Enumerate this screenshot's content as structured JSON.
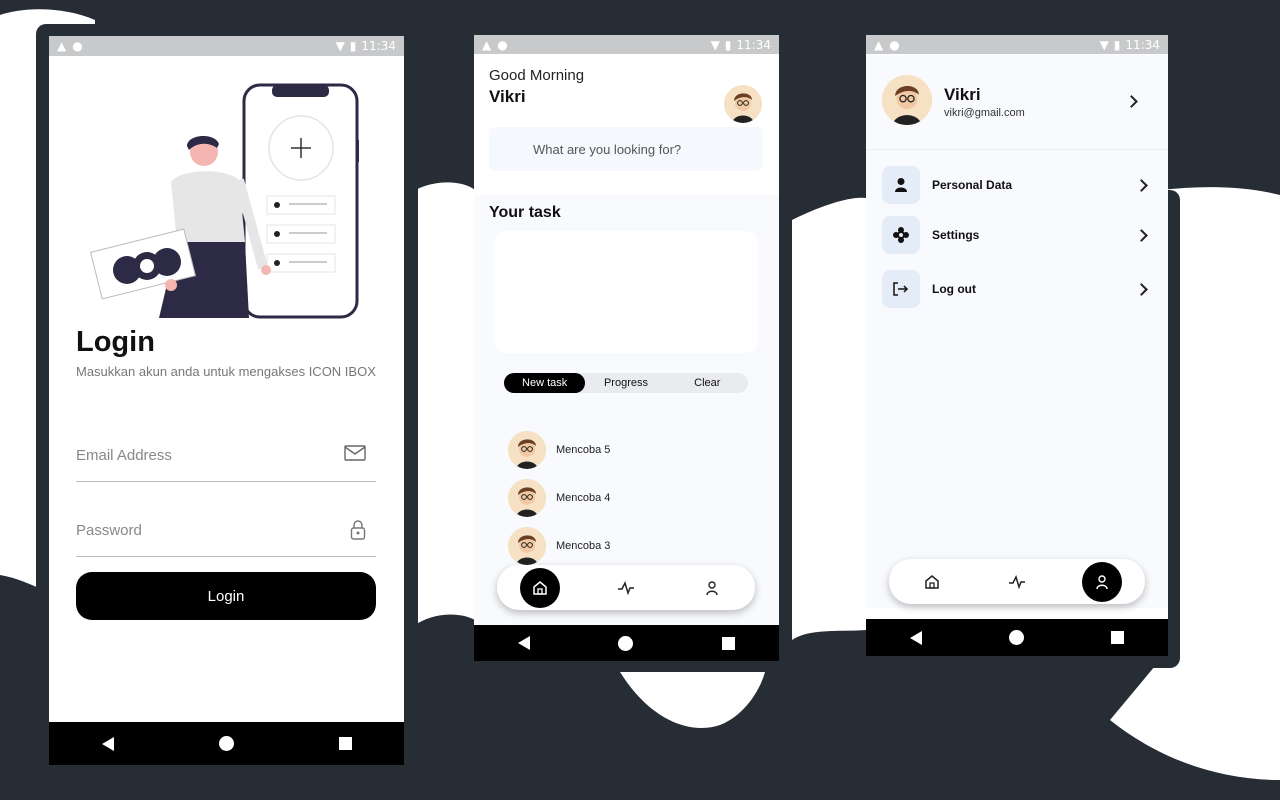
{
  "status_bar": {
    "time": "11:34"
  },
  "login_screen": {
    "title": "Login",
    "subtitle": "Masukkan akun anda untuk mengakses ICON IBOX",
    "email_placeholder": "Email Address",
    "password_placeholder": "Password",
    "login_button": "Login"
  },
  "home_screen": {
    "greeting": "Good Morning",
    "user_name": "Vikri",
    "search_placeholder": "What are you looking for?",
    "section_title": "Your task",
    "tabs": [
      {
        "label": "New task",
        "active": true
      },
      {
        "label": "Progress",
        "active": false
      },
      {
        "label": "Clear",
        "active": false
      }
    ],
    "tasks": [
      {
        "label": "Mencoba 5"
      },
      {
        "label": "Mencoba 4"
      },
      {
        "label": "Mencoba 3"
      }
    ],
    "active_nav": "home"
  },
  "profile_screen": {
    "name": "Vikri",
    "email": "vikri@gmail.com",
    "menu": [
      {
        "label": "Personal Data",
        "icon": "person-icon"
      },
      {
        "label": "Settings",
        "icon": "settings-icon"
      },
      {
        "label": "Log out",
        "icon": "logout-icon"
      }
    ],
    "active_nav": "profile"
  },
  "colors": {
    "background": "#272d35",
    "accent": "#000000",
    "icon_tile": "#e4edf7"
  }
}
